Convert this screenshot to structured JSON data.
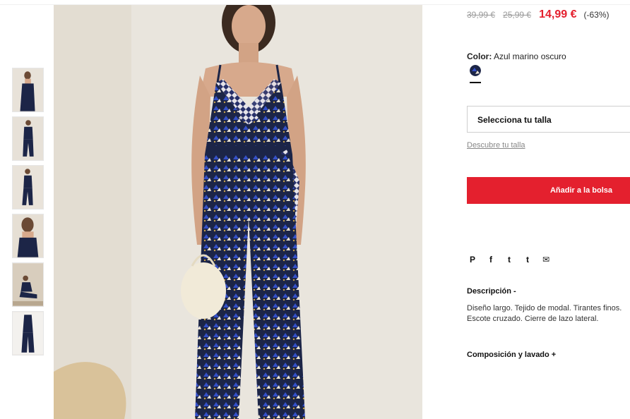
{
  "product": {
    "price_original": "39,99 €",
    "price_previous": "25,99 €",
    "price_sale": "14,99 €",
    "discount": "(-63%)"
  },
  "color": {
    "label": "Color:",
    "value": "Azul marino oscuro"
  },
  "size": {
    "select_placeholder": "Selecciona tu talla",
    "guide_link": "Descubre tu talla"
  },
  "cart": {
    "add_label": "Añadir a la bolsa"
  },
  "share": {
    "icons": [
      "pinterest-icon",
      "facebook-icon",
      "twitter-icon",
      "tumblr-icon",
      "email-icon"
    ],
    "glyphs": [
      "P",
      "f",
      "t",
      "t",
      "✉"
    ]
  },
  "description": {
    "title": "Descripción -",
    "text": "Diseño largo. Tejido de modal. Tirantes finos. Escote cruzado. Cierre de lazo lateral."
  },
  "composition": {
    "title": "Composición y lavado +"
  },
  "colors": {
    "accent": "#e4202e",
    "navy": "#1c2547",
    "backdrop": "#e9e5dd"
  }
}
